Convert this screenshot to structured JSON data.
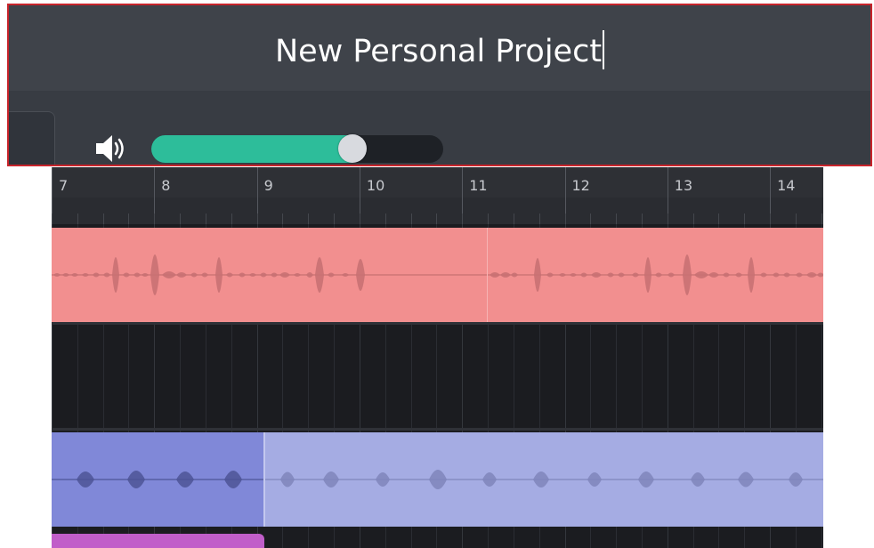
{
  "project": {
    "title": "New Personal Project"
  },
  "volume": {
    "level": 0.69,
    "fill_color": "#2dbd9a",
    "icon": "speaker-icon"
  },
  "side_tab": {
    "icon": "pencil-icon"
  },
  "timeline": {
    "ruler_labels": [
      "7",
      "8",
      "9",
      "10",
      "11",
      "12",
      "13",
      "14"
    ]
  },
  "tracks": [
    {
      "name": "audio-track-1",
      "color": "#f28f8f",
      "clips": 2
    },
    {
      "name": "empty-track",
      "color": "#1b1c20",
      "clips": 0
    },
    {
      "name": "audio-track-2",
      "color": "#a5ace3",
      "selected_color": "#8088d8",
      "clips": 2
    },
    {
      "name": "audio-track-3",
      "color": "#c15ec9",
      "clips": 1
    }
  ]
}
